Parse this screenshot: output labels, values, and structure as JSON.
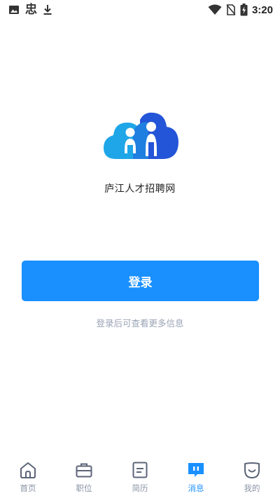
{
  "status_bar": {
    "time": "3:20",
    "icons": [
      "image-icon",
      "chinese-char-notification-icon",
      "download-icon",
      "wifi-icon",
      "no-sim-icon",
      "battery-charging-icon"
    ],
    "notification_glyph": "忠"
  },
  "app": {
    "name": "庐江人才招聘网",
    "logo": "people-cloud-logo"
  },
  "login": {
    "button_label": "登录",
    "hint": "登录后可查看更多信息"
  },
  "bottom_nav": {
    "items": [
      {
        "label": "首页",
        "icon": "home-icon",
        "active": false
      },
      {
        "label": "职位",
        "icon": "briefcase-icon",
        "active": false
      },
      {
        "label": "简历",
        "icon": "resume-icon",
        "active": false
      },
      {
        "label": "消息",
        "icon": "message-icon",
        "active": true
      },
      {
        "label": "我的",
        "icon": "profile-icon",
        "active": false
      }
    ]
  },
  "colors": {
    "accent": "#1a90ff",
    "inactive": "#8a93a6",
    "hint": "#9aa3b5",
    "logo_light": "#1ea6e8",
    "logo_dark": "#2355d8"
  }
}
